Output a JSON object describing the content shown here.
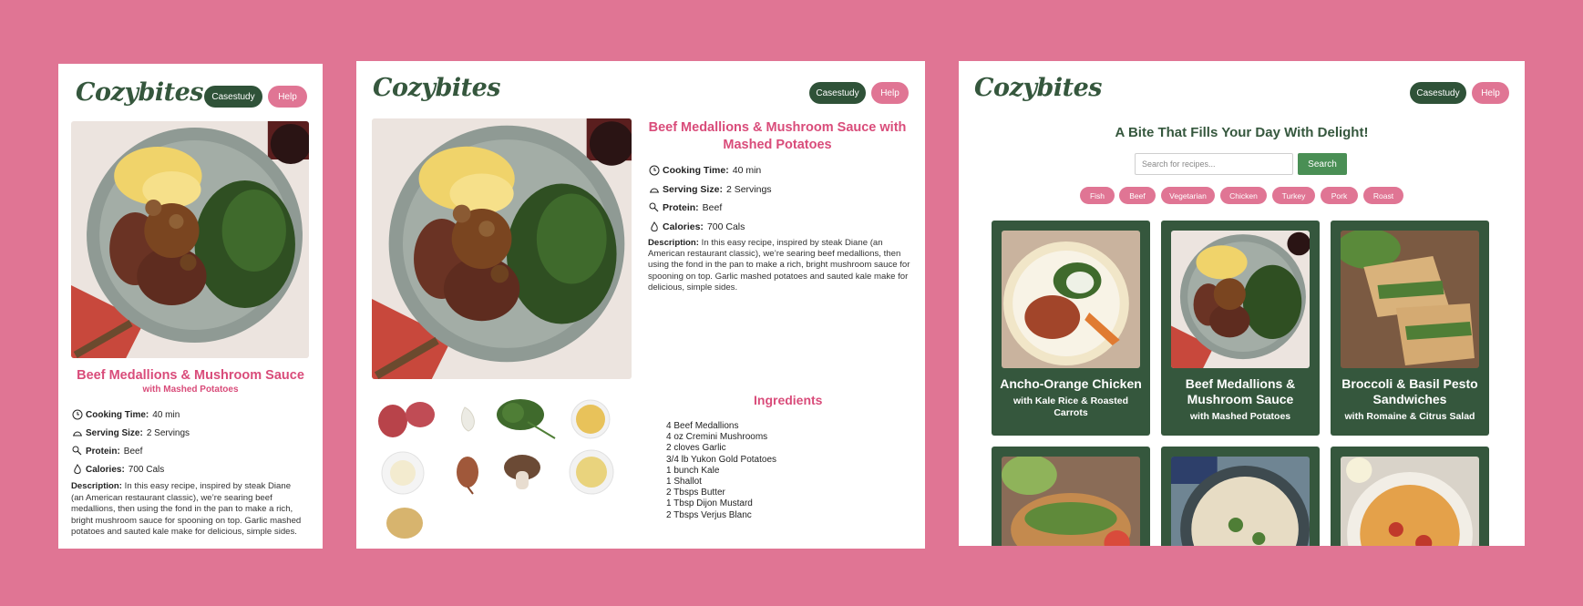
{
  "brand": {
    "logo": "Cozybites"
  },
  "nav": {
    "casestudy": "Casestudy",
    "help": "Help"
  },
  "recipe": {
    "title": "Beef Medallions & Mushroom Sauce",
    "subtitle": "with Mashed Potatoes",
    "full_title": "Beef Medallions & Mushroom Sauce with Mashed Potatoes",
    "facts": [
      {
        "icon": "clock-icon",
        "label": "Cooking Time:",
        "value": "40 min"
      },
      {
        "icon": "cloche-icon",
        "label": "Serving Size:",
        "value": "2 Servings"
      },
      {
        "icon": "drumstick-icon",
        "label": "Protein:",
        "value": "Beef"
      },
      {
        "icon": "flame-icon",
        "label": "Calories:",
        "value": "700 Cals"
      }
    ],
    "description_label": "Description:",
    "description": "In this easy recipe, inspired by steak Diane (an American restaurant classic), we’re searing beef medallions, then using the fond in the pan to make a rich, bright mushroom sauce for spooning on top. Garlic mashed potatoes and sauted kale make for delicious, simple sides.",
    "ingredients_title": "Ingredients",
    "ingredients": [
      "4 Beef Medallions",
      "4 oz Cremini Mushrooms",
      "2 cloves Garlic",
      "3/4 lb Yukon Gold Potatoes",
      "1 bunch Kale",
      "1 Shallot",
      "2 Tbsps Butter",
      "1 Tbsp Dijon Mustard",
      "2 Tbsps Verjus Blanc"
    ]
  },
  "home": {
    "hero": "A Bite That Fills Your Day With Delight!",
    "search_placeholder": "Search for recipes...",
    "search_button": "Search",
    "filters": [
      "Fish",
      "Beef",
      "Vegetarian",
      "Chicken",
      "Turkey",
      "Pork",
      "Roast"
    ],
    "cards": [
      {
        "title": "Ancho-Orange Chicken",
        "subtitle": "with Kale Rice & Roasted Carrots"
      },
      {
        "title": "Beef Medallions & Mushroom Sauce",
        "subtitle": "with Mashed Potatoes"
      },
      {
        "title": "Broccoli & Basil Pesto Sandwiches",
        "subtitle": "with Romaine & Citrus Salad"
      }
    ]
  },
  "colors": {
    "background": "#e07594",
    "brand_green": "#35573d",
    "accent_pink": "#d94c7a",
    "search_green": "#4a8f55"
  }
}
